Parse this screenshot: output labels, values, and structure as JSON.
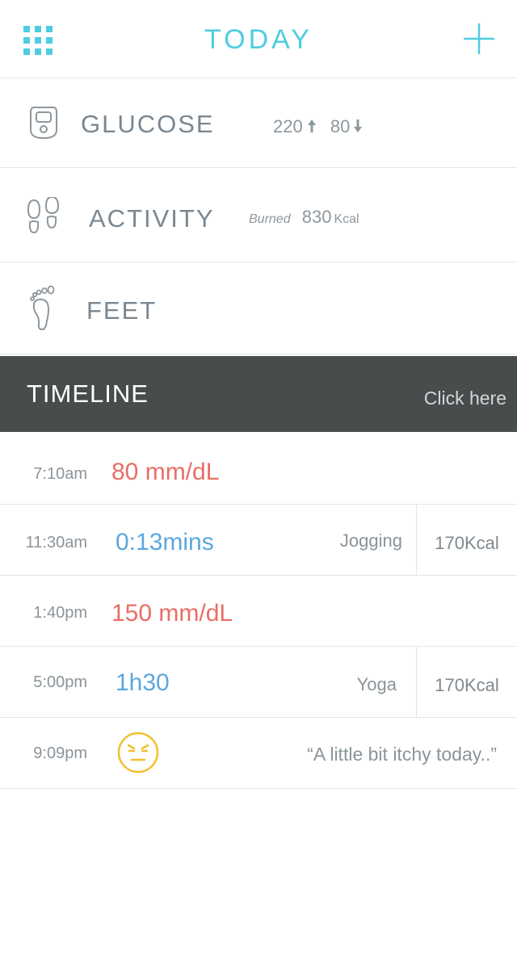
{
  "header": {
    "title": "TODAY",
    "accent_color": "#4fcde0",
    "menu_icon": "grid-menu-icon",
    "add_icon": "plus-icon"
  },
  "categories": {
    "glucose": {
      "label": "GLUCOSE",
      "icon": "glucometer-icon",
      "high": "220",
      "low": "80",
      "high_icon": "arrow-up-icon",
      "low_icon": "arrow-down-icon"
    },
    "activity": {
      "label": "ACTIVITY",
      "icon": "footprints-icon",
      "burned_label": "Burned",
      "burned_value": "830",
      "burned_unit": "Kcal"
    },
    "feet": {
      "label": "FEET",
      "icon": "foot-icon"
    }
  },
  "timeline": {
    "title": "TIMELINE",
    "action": "Click here",
    "bar_color": "#474c4d",
    "entries": [
      {
        "time": "7:10am",
        "value": "80 mm/dL"
      },
      {
        "time": "11:30am",
        "value": "0:13mins",
        "activity": "Jogging",
        "kcal": "170Kcal"
      },
      {
        "time": "1:40pm",
        "value": "150 mm/dL"
      },
      {
        "time": "5:00pm",
        "value": "1h30",
        "activity": "Yoga",
        "kcal": "170Kcal"
      },
      {
        "time": "9:09pm",
        "mood_icon": "annoyed-face-icon",
        "note": "“A little bit itchy today..”"
      }
    ]
  },
  "colors": {
    "glucose_value": "#e86e66",
    "activity_value": "#5ba8dd",
    "mood": "#f2c02e"
  }
}
